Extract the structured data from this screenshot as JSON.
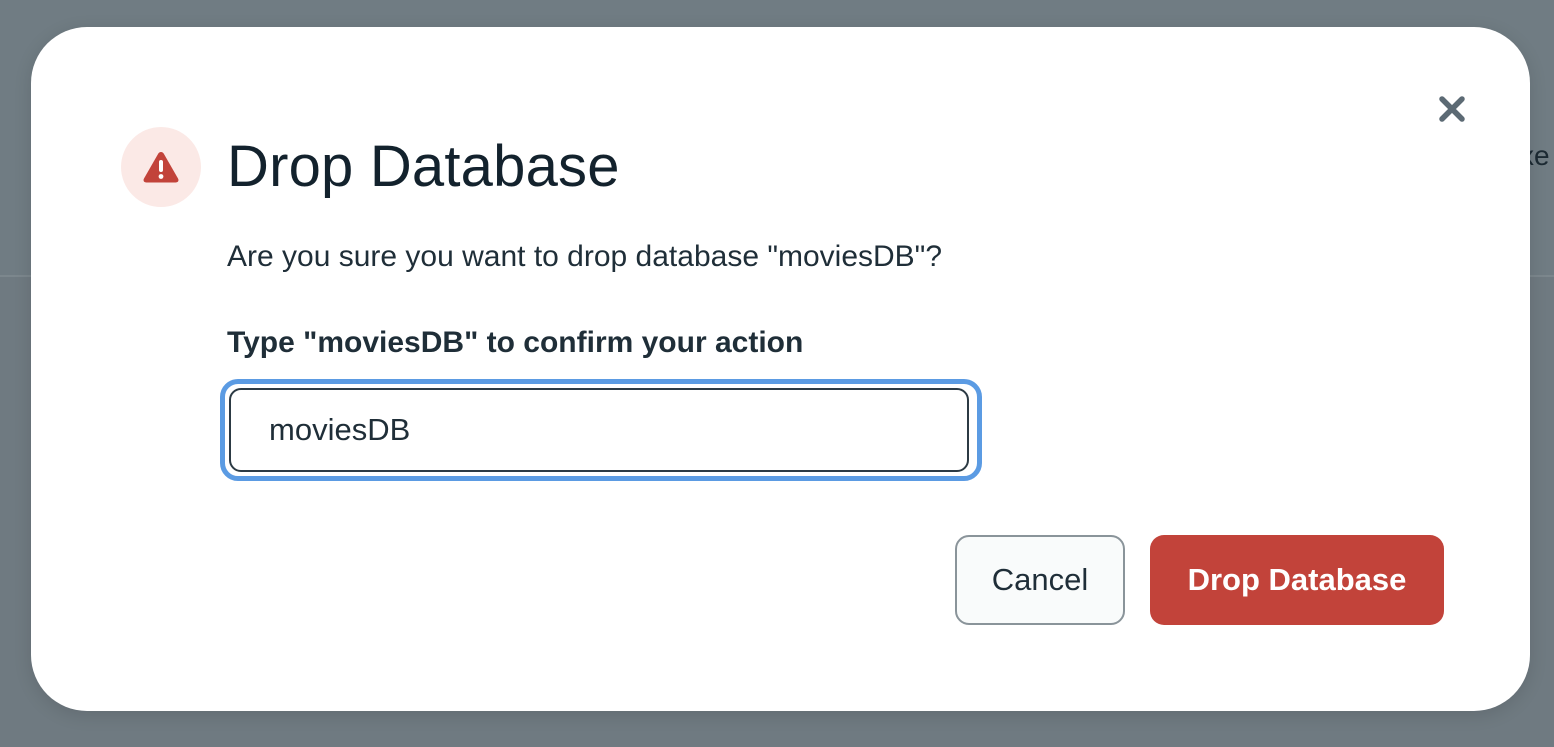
{
  "background": {
    "partial_text": "xe"
  },
  "dialog": {
    "title": "Drop Database",
    "message": "Are you sure you want to drop database \"moviesDB\"?",
    "confirm_label": "Type \"moviesDB\" to confirm your action",
    "input_value": "moviesDB",
    "cancel_label": "Cancel",
    "drop_label": "Drop Database",
    "icons": {
      "warning": "warning-icon",
      "close": "close-icon"
    },
    "colors": {
      "danger": "#c2433a",
      "warning_bg": "#fbe9e6",
      "focus_ring": "#5b9be3",
      "text": "#13222d"
    }
  }
}
